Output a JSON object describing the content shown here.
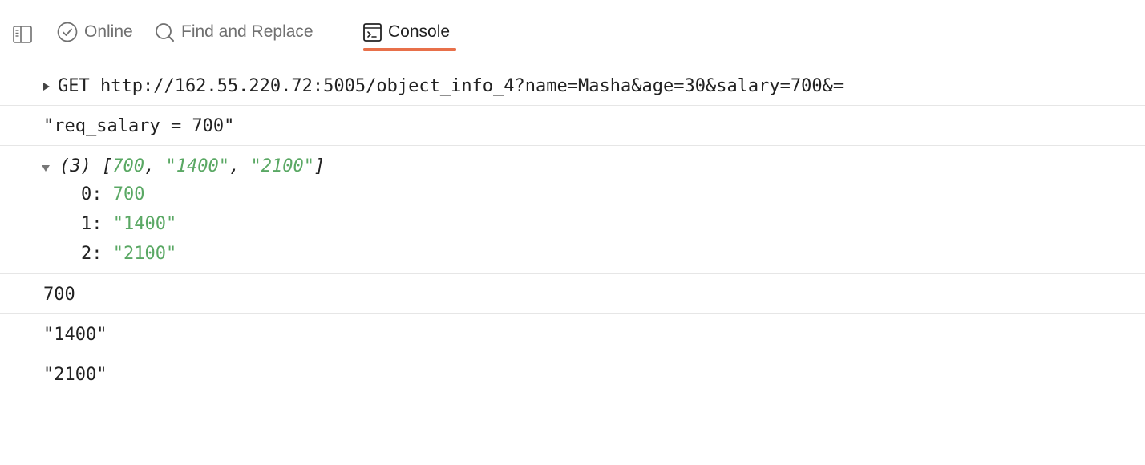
{
  "toolbar": {
    "online_label": "Online",
    "find_label": "Find and Replace",
    "console_label": "Console",
    "accent_color": "#e8704a"
  },
  "console": {
    "request": "GET http://162.55.220.72:5005/object_info_4?name=Masha&age=30&salary=700&=",
    "log1": "\"req_salary = 700\"",
    "array": {
      "count": "(3)",
      "open": "[",
      "v0": "700",
      "v1": "\"1400\"",
      "v2": "\"2100\"",
      "sep": ", ",
      "close": "]",
      "items": [
        {
          "index": "0:",
          "value": "700"
        },
        {
          "index": "1:",
          "value": "\"1400\""
        },
        {
          "index": "2:",
          "value": "\"2100\""
        }
      ]
    },
    "log2": "700",
    "log3": "\"1400\"",
    "log4": "\"2100\""
  }
}
